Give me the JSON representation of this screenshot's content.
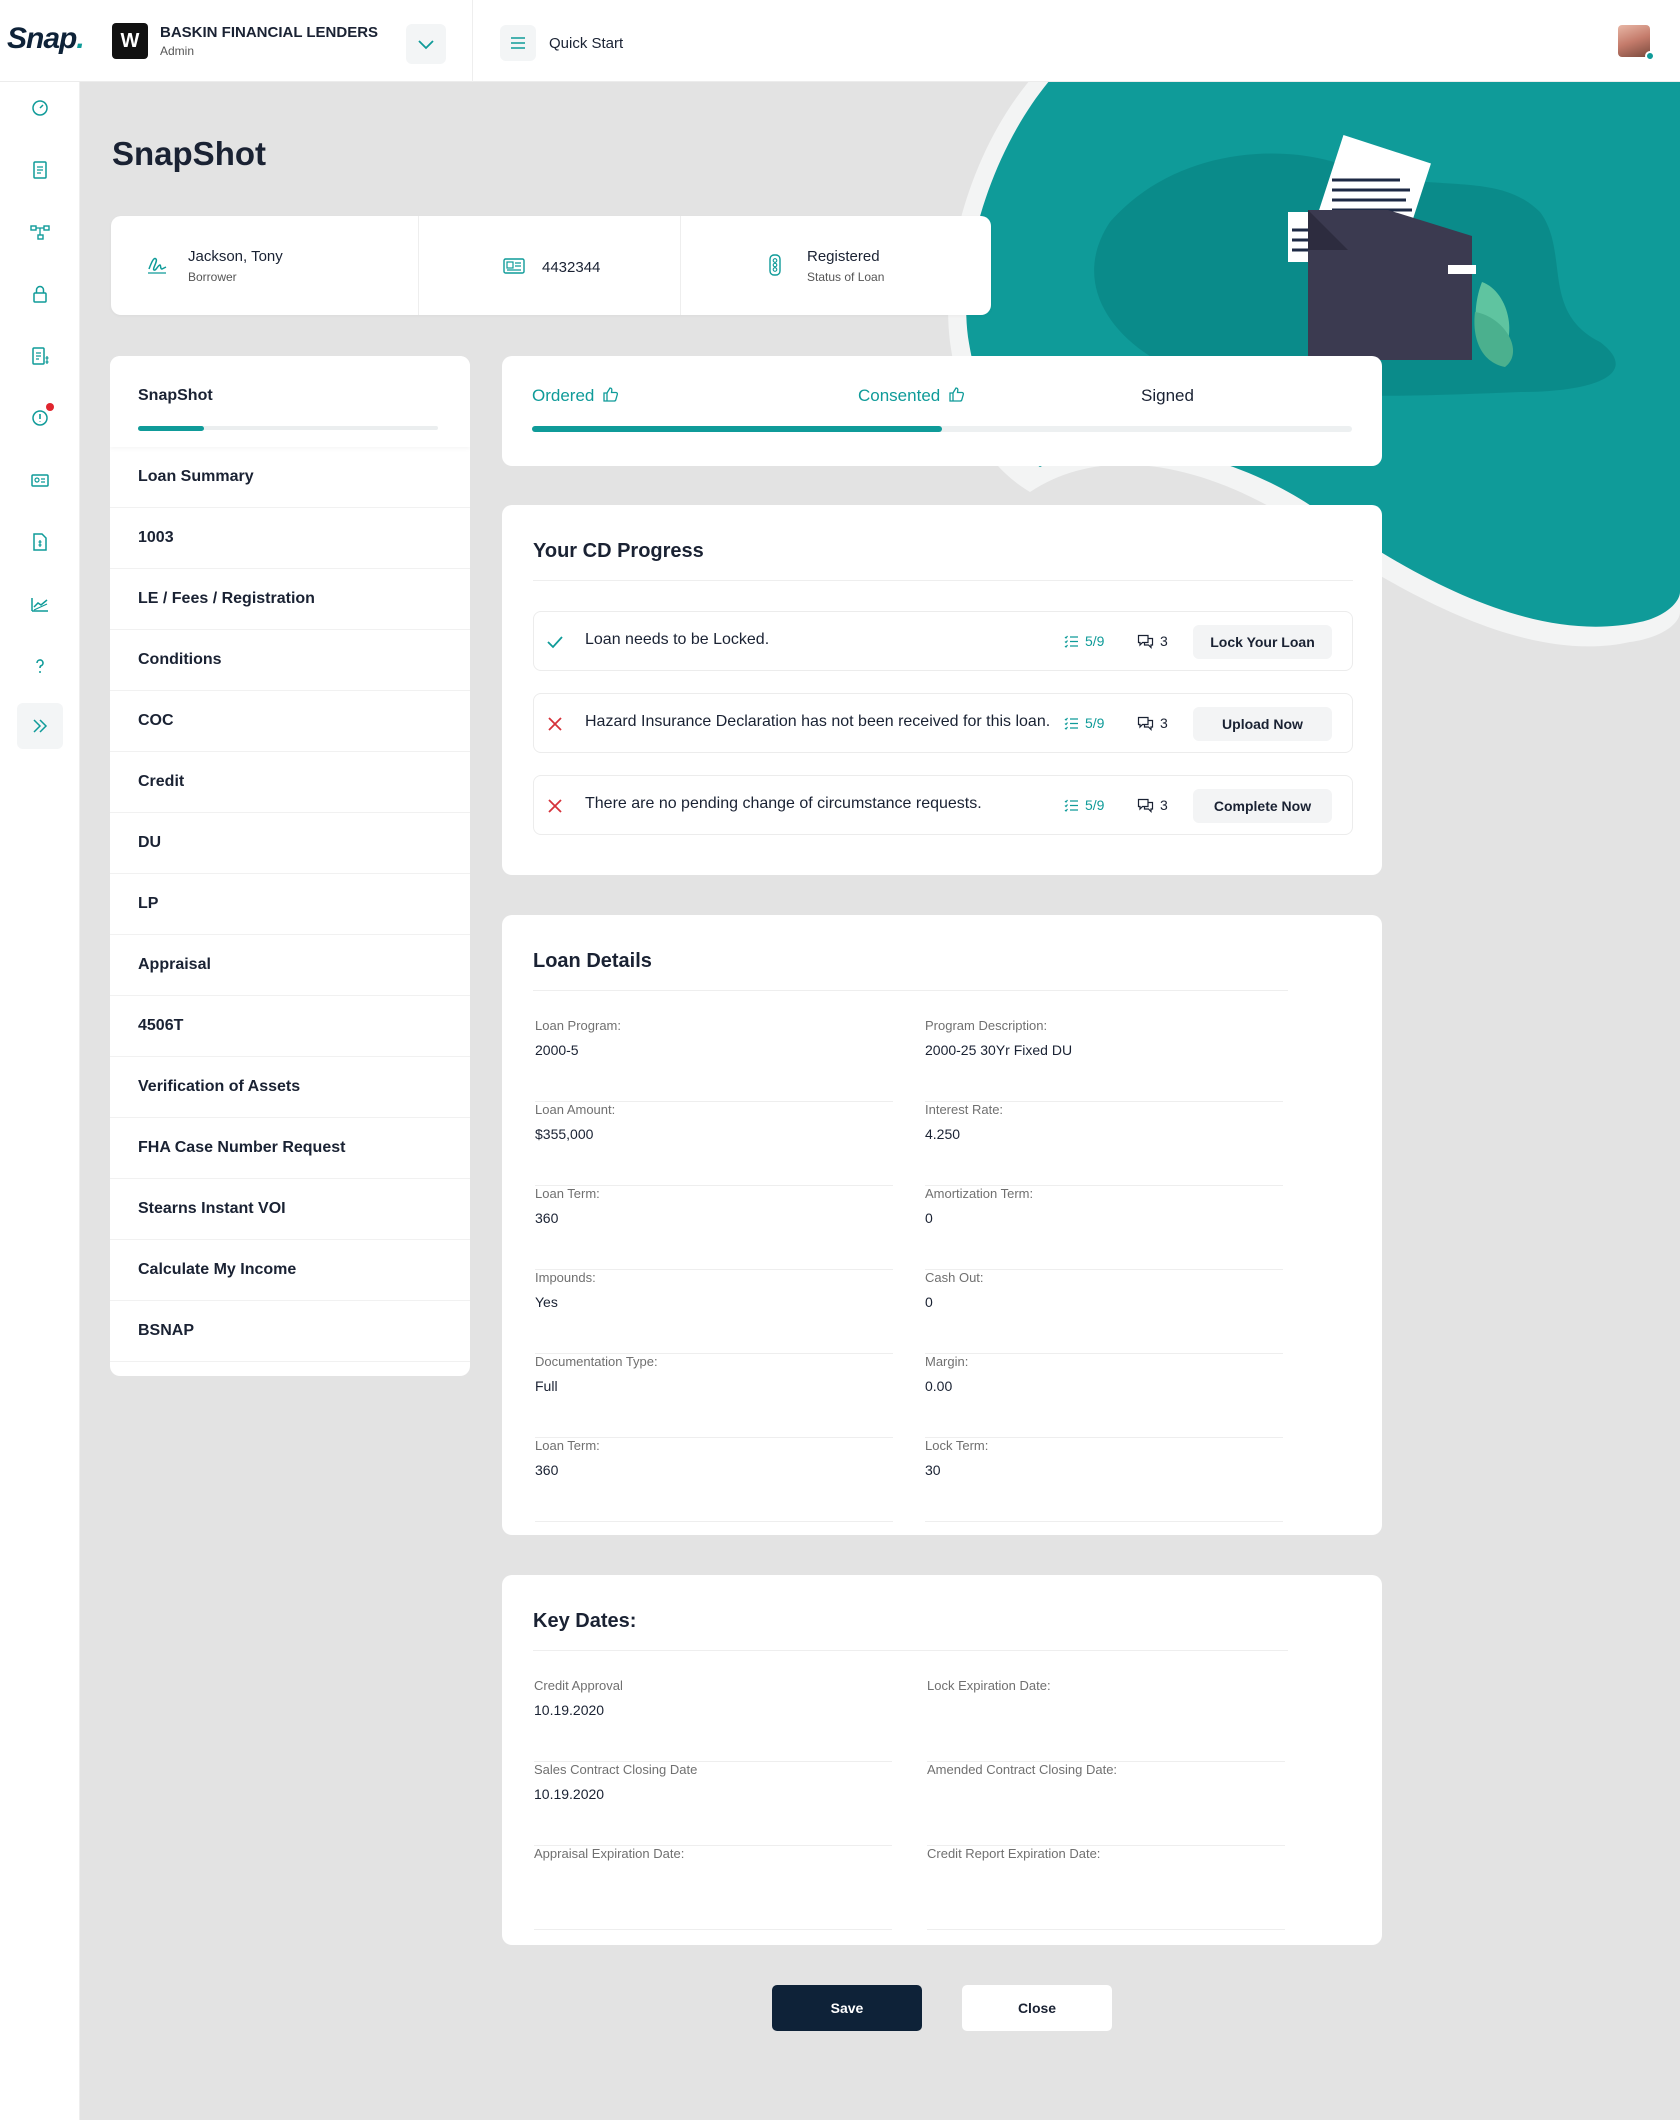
{
  "brand": {
    "logo_text": "Snap",
    "logo_dot": ".",
    "accent": "#0f9b99",
    "navy": "#0e2238"
  },
  "org": {
    "badge": "W",
    "name": "BASKIN FINANCIAL LENDERS",
    "role": "Admin"
  },
  "header": {
    "quick_start": "Quick Start"
  },
  "sidebar_icons": [
    "dashboard-icon",
    "document-icon",
    "workflow-icon",
    "lock-icon",
    "invoice-icon",
    "alert-icon",
    "id-card-icon",
    "file-dollar-icon",
    "chart-icon",
    "help-icon",
    "expand-icon"
  ],
  "page": {
    "title": "SnapShot"
  },
  "info": {
    "borrower_name": "Jackson, Tony",
    "borrower_label": "Borrower",
    "loan_number": "4432344",
    "status": "Registered",
    "status_label": "Status of Loan"
  },
  "nav": {
    "header": "SnapShot",
    "progress": 0.22,
    "items": [
      "Loan Summary",
      "1003",
      "LE / Fees / Registration",
      "Conditions",
      "COC",
      "Credit",
      "DU",
      "LP",
      "Appraisal",
      "4506T",
      "Verification of Assets",
      "FHA Case Number Request",
      "Stearns Instant VOI",
      "Calculate My Income",
      "BSNAP"
    ]
  },
  "status": {
    "steps": [
      {
        "label": "Ordered",
        "done": true
      },
      {
        "label": "Consented",
        "done": true
      },
      {
        "label": "Signed",
        "done": false
      }
    ],
    "progress": 0.5
  },
  "cd_progress": {
    "title": "Your CD Progress",
    "tasks": [
      {
        "text": "Loan needs to be Locked.",
        "state": "done",
        "count": "5/9",
        "messages": "3",
        "action": "Lock Your Loan"
      },
      {
        "text": "Hazard Insurance Declaration has not been received for this loan.",
        "state": "fail",
        "count": "5/9",
        "messages": "3",
        "action": "Upload Now"
      },
      {
        "text": "There are no pending change of circumstance requests.",
        "state": "fail",
        "count": "5/9",
        "messages": "3",
        "action": "Complete Now"
      }
    ]
  },
  "loan_details": {
    "title": "Loan Details",
    "fields": [
      {
        "label": "Loan Program:",
        "value": "2000-5"
      },
      {
        "label": "Program Description:",
        "value": "2000-25 30Yr Fixed DU"
      },
      {
        "label": "Loan Amount:",
        "value": "$355,000"
      },
      {
        "label": "Interest Rate:",
        "value": "4.250"
      },
      {
        "label": "Loan Term:",
        "value": "360"
      },
      {
        "label": "Amortization Term:",
        "value": "0"
      },
      {
        "label": "Impounds:",
        "value": "Yes"
      },
      {
        "label": "Cash Out:",
        "value": "0"
      },
      {
        "label": "Documentation Type:",
        "value": "Full"
      },
      {
        "label": "Margin:",
        "value": "0.00"
      },
      {
        "label": "Loan Term:",
        "value": "360"
      },
      {
        "label": "Lock Term:",
        "value": "30"
      }
    ]
  },
  "key_dates": {
    "title": "Key Dates:",
    "fields": [
      {
        "label": "Credit Approval",
        "value": "10.19.2020"
      },
      {
        "label": "Lock Expiration Date:",
        "value": ""
      },
      {
        "label": "Sales Contract Closing Date",
        "value": "10.19.2020"
      },
      {
        "label": "Amended Contract Closing Date:",
        "value": ""
      },
      {
        "label": "Appraisal Expiration Date:",
        "value": ""
      },
      {
        "label": "Credit Report Expiration Date:",
        "value": ""
      }
    ]
  },
  "actions": {
    "save": "Save",
    "close": "Close"
  }
}
